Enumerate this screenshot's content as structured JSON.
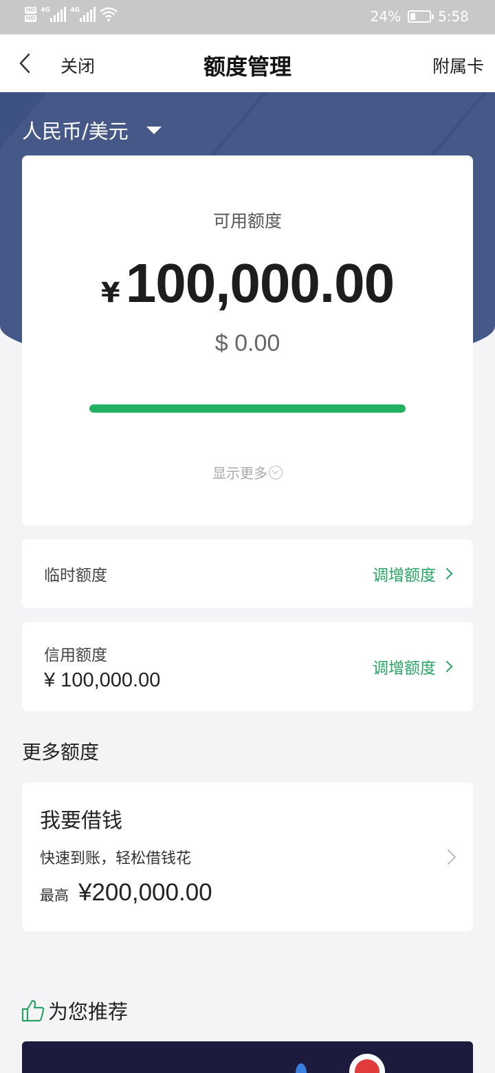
{
  "status_bar": {
    "hd1": "HD",
    "hd2": "HD",
    "net1": "4G",
    "net2": "4G",
    "battery": "24%",
    "time": "5:58",
    "battery_level": 0.24
  },
  "nav": {
    "close": "关闭",
    "title": "额度管理",
    "right": "附属卡"
  },
  "currency_selector": "人民币/美元",
  "summary": {
    "available_label": "可用额度",
    "currency_symbol": "¥",
    "available_amount": "100,000.00",
    "usd_amount": "$ 0.00",
    "usage_fraction": 1.0,
    "show_more": "显示更多"
  },
  "temp_limit": {
    "label": "临时额度",
    "action": "调增额度"
  },
  "credit_limit": {
    "label": "信用额度",
    "value": "¥ 100,000.00",
    "action": "调增额度"
  },
  "more_section": {
    "title": "更多额度"
  },
  "loan": {
    "title": "我要借钱",
    "desc": "快速到账，轻松借钱花",
    "max_label": "最高",
    "max_amount": "¥200,000.00"
  },
  "recommend": {
    "title": "为您推荐"
  },
  "colors": {
    "accent_green": "#27a464",
    "progress_green": "#21b161",
    "hero_blue": "#3d5182"
  }
}
